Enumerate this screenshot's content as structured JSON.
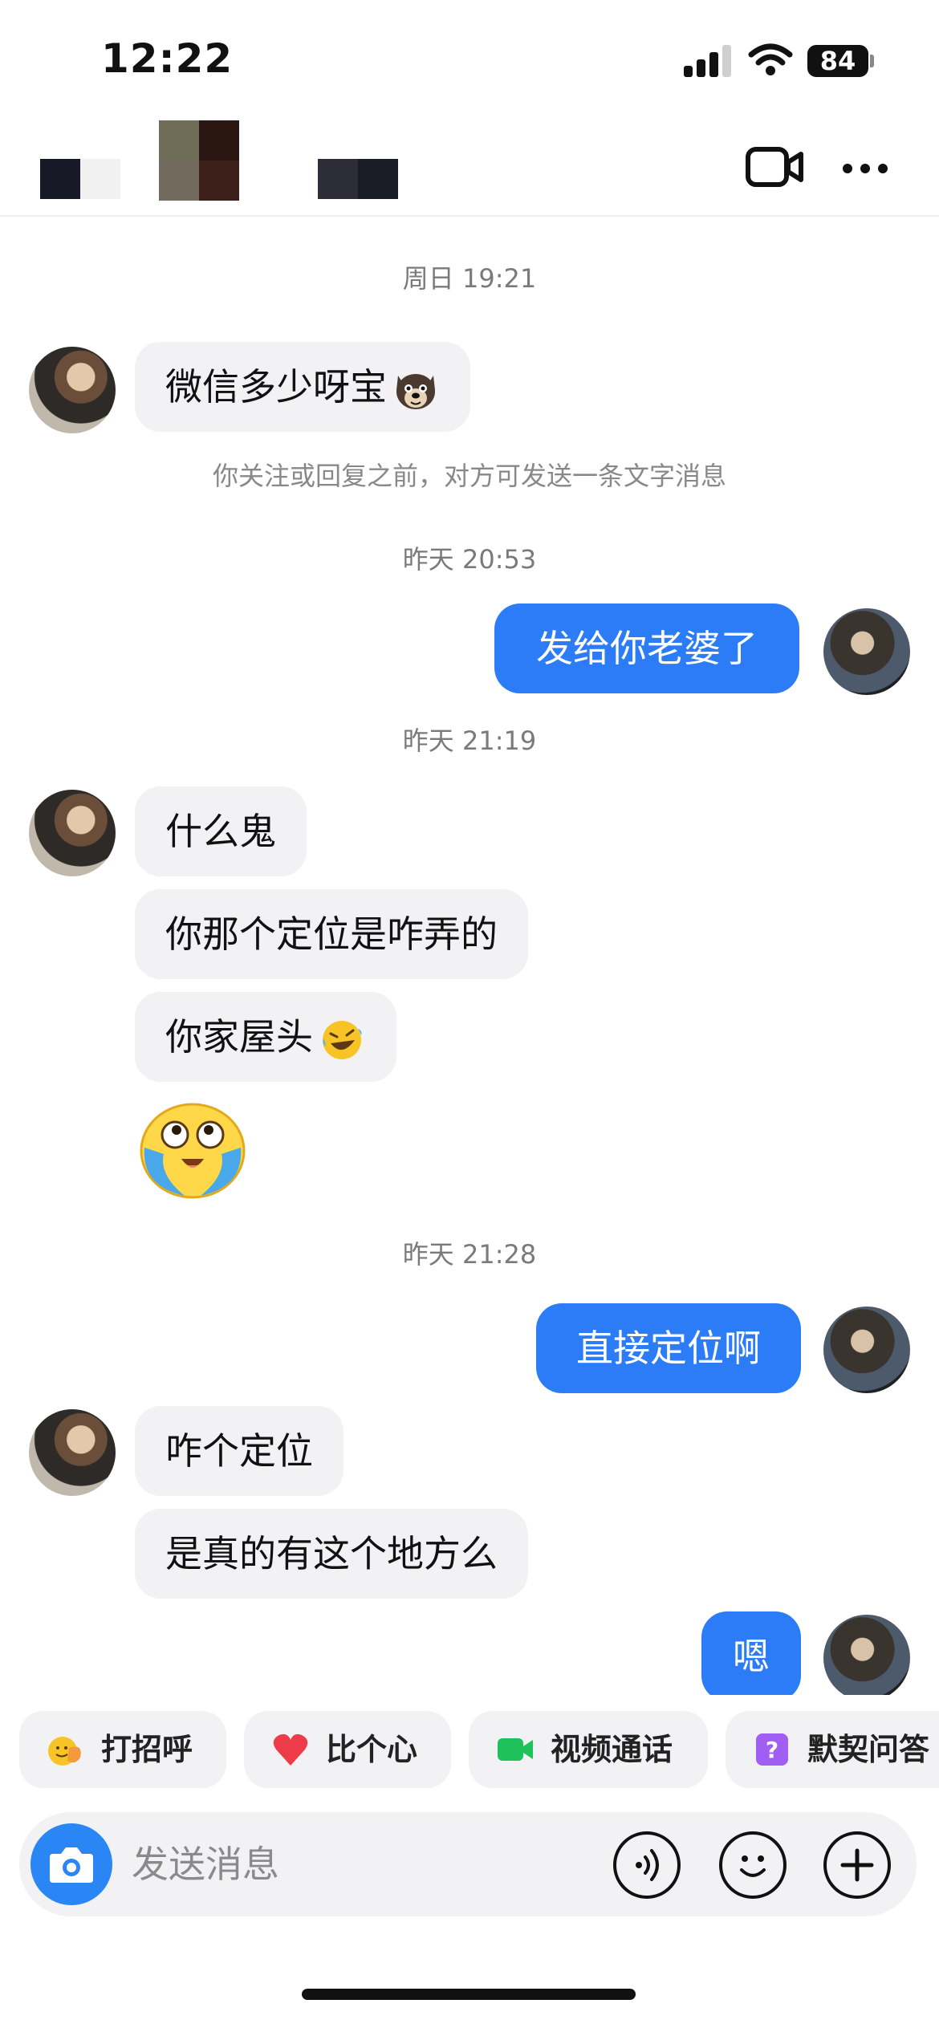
{
  "status_bar": {
    "time": "12:22",
    "battery": "84"
  },
  "header": {
    "contact_name_pixelated": true,
    "video_icon": "video-camera-icon",
    "more_icon": "more-dots-icon"
  },
  "chat": {
    "timestamps": [
      "周日 19:21",
      "昨天 20:53",
      "昨天 21:19",
      "昨天 21:28"
    ],
    "notice": "你关注或回复之前，对方可发送一条文字消息",
    "messages": [
      {
        "from": "them",
        "text": "微信多少呀宝",
        "emoji": "dog-face-emoji"
      },
      {
        "from": "me",
        "text": "发给你老婆了"
      },
      {
        "from": "them",
        "text": "什么鬼"
      },
      {
        "from": "them",
        "text": "你那个定位是咋弄的"
      },
      {
        "from": "them",
        "text": "你家屋头",
        "emoji": "rolling-laughing-emoji"
      },
      {
        "from": "them",
        "sticker": "crying-face-sticker"
      },
      {
        "from": "me",
        "text": "直接定位啊"
      },
      {
        "from": "them",
        "text": "咋个定位"
      },
      {
        "from": "them",
        "text": "是真的有这个地方么"
      },
      {
        "from": "me",
        "text": "嗯"
      }
    ]
  },
  "quick_actions": [
    {
      "label": "打招呼",
      "icon": "wave-hand-icon"
    },
    {
      "label": "比个心",
      "icon": "heart-icon"
    },
    {
      "label": "视频通话",
      "icon": "video-call-icon"
    },
    {
      "label": "默契问答",
      "icon": "question-box-icon"
    }
  ],
  "input": {
    "placeholder": "发送消息",
    "camera_icon": "camera-icon",
    "voice_icon": "voice-icon",
    "emoji_icon": "smiley-icon",
    "plus_icon": "plus-icon"
  },
  "colors": {
    "accent": "#2b7cf6",
    "bubble_in": "#f2f2f4",
    "timestamp": "#7a7a7a"
  }
}
